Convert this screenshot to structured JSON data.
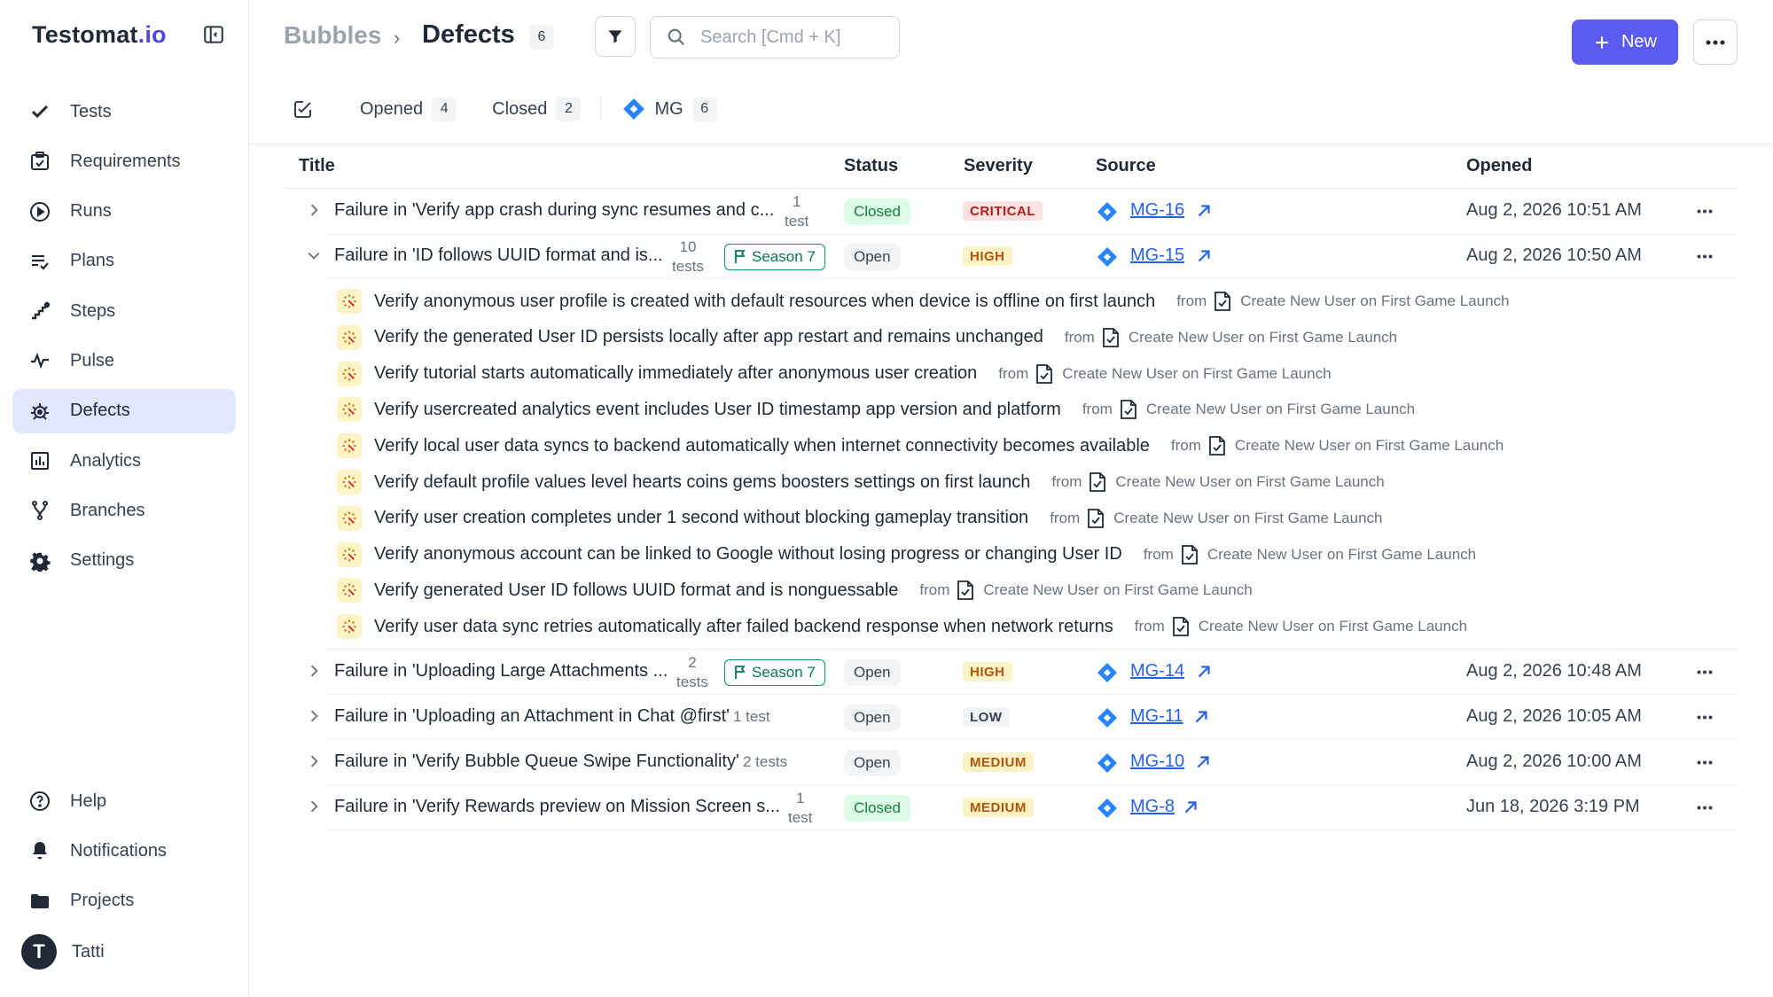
{
  "app": {
    "logo_main": "Testomat",
    "logo_suffix": ".io"
  },
  "sidebar": {
    "items": [
      {
        "label": "Tests",
        "icon": "check-icon"
      },
      {
        "label": "Requirements",
        "icon": "clipboard-check-icon"
      },
      {
        "label": "Runs",
        "icon": "play-circle-icon"
      },
      {
        "label": "Plans",
        "icon": "list-check-icon"
      },
      {
        "label": "Steps",
        "icon": "steps-icon"
      },
      {
        "label": "Pulse",
        "icon": "pulse-icon"
      },
      {
        "label": "Defects",
        "icon": "bug-icon",
        "active": true
      },
      {
        "label": "Analytics",
        "icon": "bar-chart-icon"
      },
      {
        "label": "Branches",
        "icon": "branch-icon"
      },
      {
        "label": "Settings",
        "icon": "gear-icon"
      }
    ],
    "bottom": [
      {
        "label": "Help",
        "icon": "help-circle-icon"
      },
      {
        "label": "Notifications",
        "icon": "bell-icon"
      },
      {
        "label": "Projects",
        "icon": "folder-icon"
      }
    ],
    "user": {
      "name": "Tatti",
      "initial": "T"
    }
  },
  "header": {
    "project": "Bubbles",
    "separator": "›",
    "title": "Defects",
    "count": "6",
    "search_placeholder": "Search [Cmd + K]",
    "new_label": "New"
  },
  "tabs": {
    "opened_label": "Opened",
    "opened_count": "4",
    "closed_label": "Closed",
    "closed_count": "2",
    "mg_label": "MG",
    "mg_count": "6"
  },
  "columns": {
    "title": "Title",
    "status": "Status",
    "severity": "Severity",
    "source": "Source",
    "opened": "Opened"
  },
  "defects": [
    {
      "title": "Failure in 'Verify app crash during sync resumes and c...",
      "tests_line1": "1",
      "tests_line2": "test",
      "status": "Closed",
      "severity": "CRITICAL",
      "source": "MG-16",
      "opened": "Aug 2, 2026 10:51 AM"
    },
    {
      "title": "Failure in 'ID follows UUID format and is...",
      "tests_line1": "10",
      "tests_line2": "tests",
      "label": "Season 7",
      "status": "Open",
      "severity": "HIGH",
      "source": "MG-15",
      "opened": "Aug 2, 2026 10:50 AM"
    },
    {
      "title": "Failure in 'Uploading Large Attachments ...",
      "tests_line1": "2",
      "tests_line2": "tests",
      "label": "Season 7",
      "status": "Open",
      "severity": "HIGH",
      "source": "MG-14",
      "opened": "Aug 2, 2026 10:48 AM"
    },
    {
      "title": "Failure in 'Uploading an Attachment in Chat @first'",
      "tests_inline": "1 test",
      "status": "Open",
      "severity": "LOW",
      "source": "MG-11",
      "opened": "Aug 2, 2026 10:05 AM"
    },
    {
      "title": "Failure in 'Verify Bubble Queue Swipe Functionality'",
      "tests_inline": "2 tests",
      "status": "Open",
      "severity": "MEDIUM",
      "source": "MG-10",
      "opened": "Aug 2, 2026 10:00 AM"
    },
    {
      "title": "Failure in 'Verify Rewards preview on Mission Screen s...",
      "tests_line1": "1",
      "tests_line2": "test",
      "status": "Closed",
      "severity": "MEDIUM",
      "source": "MG-8",
      "opened": "Jun 18, 2026 3:19 PM"
    }
  ],
  "expanded_tests": {
    "from_label": "from",
    "suite": "Create New User on First Game Launch",
    "items": [
      "Verify anonymous user profile is created with default resources when device is offline on first launch",
      "Verify the generated User ID persists locally after app restart and remains unchanged",
      "Verify tutorial starts automatically immediately after anonymous user creation",
      "Verify usercreated analytics event includes User ID timestamp app version and platform",
      "Verify local user data syncs to backend automatically when internet connectivity becomes available",
      "Verify default profile values level hearts coins gems boosters settings on first launch",
      "Verify user creation completes under 1 second without blocking gameplay transition",
      "Verify anonymous account can be linked to Google without losing progress or changing User ID",
      "Verify generated User ID follows UUID format and is nonguessable",
      "Verify user data sync retries automatically after failed backend response when network returns"
    ]
  },
  "colors": {
    "accent": "#5b5bf0",
    "active_nav": "#e0e7ff",
    "link": "#2563eb",
    "critical": "#b91c1c",
    "high": "#b45309"
  }
}
